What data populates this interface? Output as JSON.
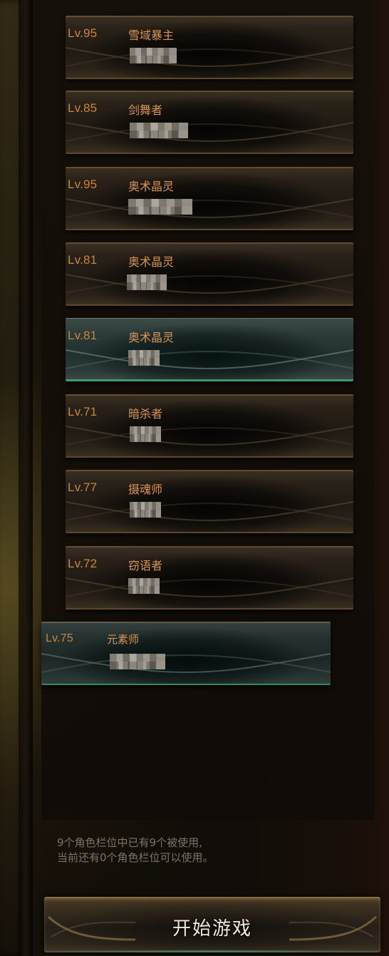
{
  "characters": [
    {
      "level": "Lv.95",
      "class_name": "雪域暴主",
      "name_censored": true
    },
    {
      "level": "Lv.85",
      "class_name": "剑舞者",
      "name_censored": true
    },
    {
      "level": "Lv.95",
      "class_name": "奥术晶灵",
      "name_censored": true
    },
    {
      "level": "Lv.81",
      "class_name": "奥术晶灵",
      "name_censored": true
    },
    {
      "level": "Lv.81",
      "class_name": "奥术晶灵",
      "name_censored": true,
      "selected": true
    },
    {
      "level": "Lv.71",
      "class_name": "暗杀者",
      "name_censored": true
    },
    {
      "level": "Lv.77",
      "class_name": "摄魂师",
      "name_censored": true
    },
    {
      "level": "Lv.72",
      "class_name": "窃语者",
      "name_censored": true
    },
    {
      "level": "Lv.75",
      "class_name": "元素师",
      "name_censored": true,
      "dragging": true
    }
  ],
  "slot_info": {
    "line1": "9个角色栏位中已有9个被使用,",
    "line2": "当前还有0个角色栏位可以使用。"
  },
  "start_button": {
    "label": "开始游戏"
  },
  "colors": {
    "level_text": "#c9863a",
    "class_text": "#d8955a",
    "selected_accent": "#3f9a7a",
    "info_text": "#7b7468",
    "button_text": "#f1eadc"
  }
}
